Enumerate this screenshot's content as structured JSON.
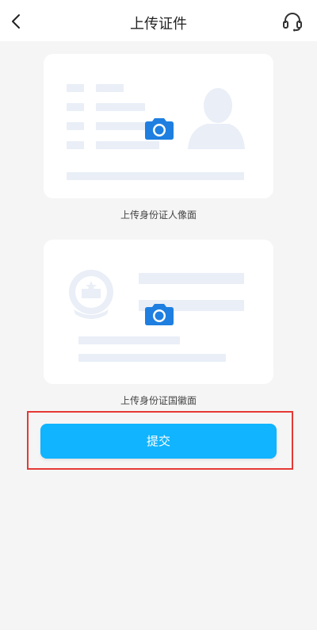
{
  "header": {
    "title": "上传证件",
    "back_icon": "chevron-left-icon",
    "support_icon": "headset-icon"
  },
  "cards": {
    "front_label": "上传身份证人像面",
    "back_label": "上传身份证国徽面",
    "camera_icon": "camera-icon"
  },
  "actions": {
    "submit_label": "提交"
  },
  "colors": {
    "accent": "#10b4ff",
    "camera": "#1e7fe0",
    "placeholder": "#e9eef7",
    "highlight": "#e53935"
  }
}
